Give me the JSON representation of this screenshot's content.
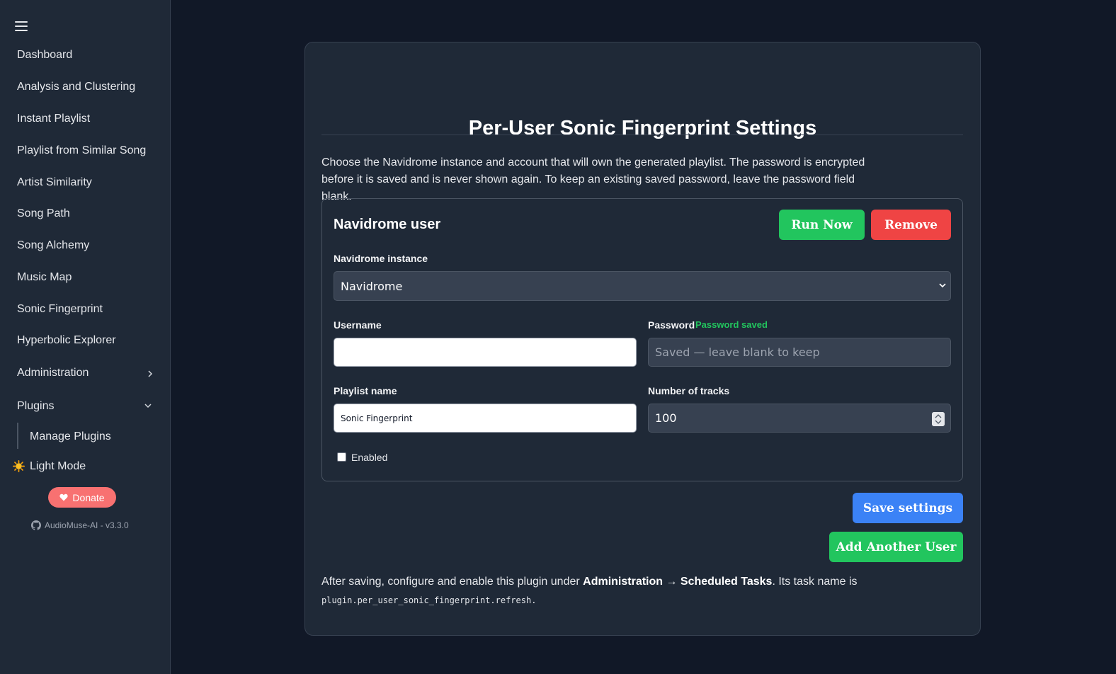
{
  "sidebar": {
    "items": [
      {
        "label": "Dashboard"
      },
      {
        "label": "Analysis and Clustering"
      },
      {
        "label": "Instant Playlist"
      },
      {
        "label": "Playlist from Similar Song"
      },
      {
        "label": "Artist Similarity"
      },
      {
        "label": "Song Path"
      },
      {
        "label": "Song Alchemy"
      },
      {
        "label": "Music Map"
      },
      {
        "label": "Sonic Fingerprint"
      },
      {
        "label": "Hyperbolic Explorer"
      },
      {
        "label": "Administration"
      },
      {
        "label": "Plugins"
      }
    ],
    "sub_item": "Manage Plugins",
    "theme_toggle": "Light Mode",
    "donate": "Donate",
    "version": "AudioMuse-AI - v3.3.0"
  },
  "main": {
    "title": "Per-User Sonic Fingerprint Settings",
    "intro": "Choose the Navidrome instance and account that will own the generated playlist. The password is encrypted before it is saved and is never shown again. To keep an existing saved password, leave the password field blank.",
    "user": {
      "heading": "Navidrome user",
      "run_now": "Run Now",
      "remove": "Remove",
      "instance_label": "Navidrome instance",
      "instance_value": "Navidrome",
      "username_label": "Username",
      "username_value": "",
      "password_label": "Password",
      "password_status": "Password saved",
      "password_placeholder": "Saved — leave blank to keep",
      "playlist_label": "Playlist name",
      "playlist_value": "Sonic Fingerprint",
      "tracks_label": "Number of tracks",
      "tracks_value": "100",
      "enabled_label": "Enabled",
      "enabled": false
    },
    "save_button": "Save settings",
    "add_user_button": "Add Another User",
    "footer": {
      "prefix": "After saving, configure and enable this plugin under ",
      "admin": "Administration",
      "arrow": " → ",
      "tasks": "Scheduled Tasks",
      "suffix": ". Its task name is",
      "task_name": "plugin.per_user_sonic_fingerprint.refresh."
    }
  },
  "colors": {
    "background": "#111827",
    "sidebar": "#1f2937",
    "green": "#22c55e",
    "red": "#ef4444",
    "blue": "#3b82f6",
    "donate": "#f87171"
  }
}
